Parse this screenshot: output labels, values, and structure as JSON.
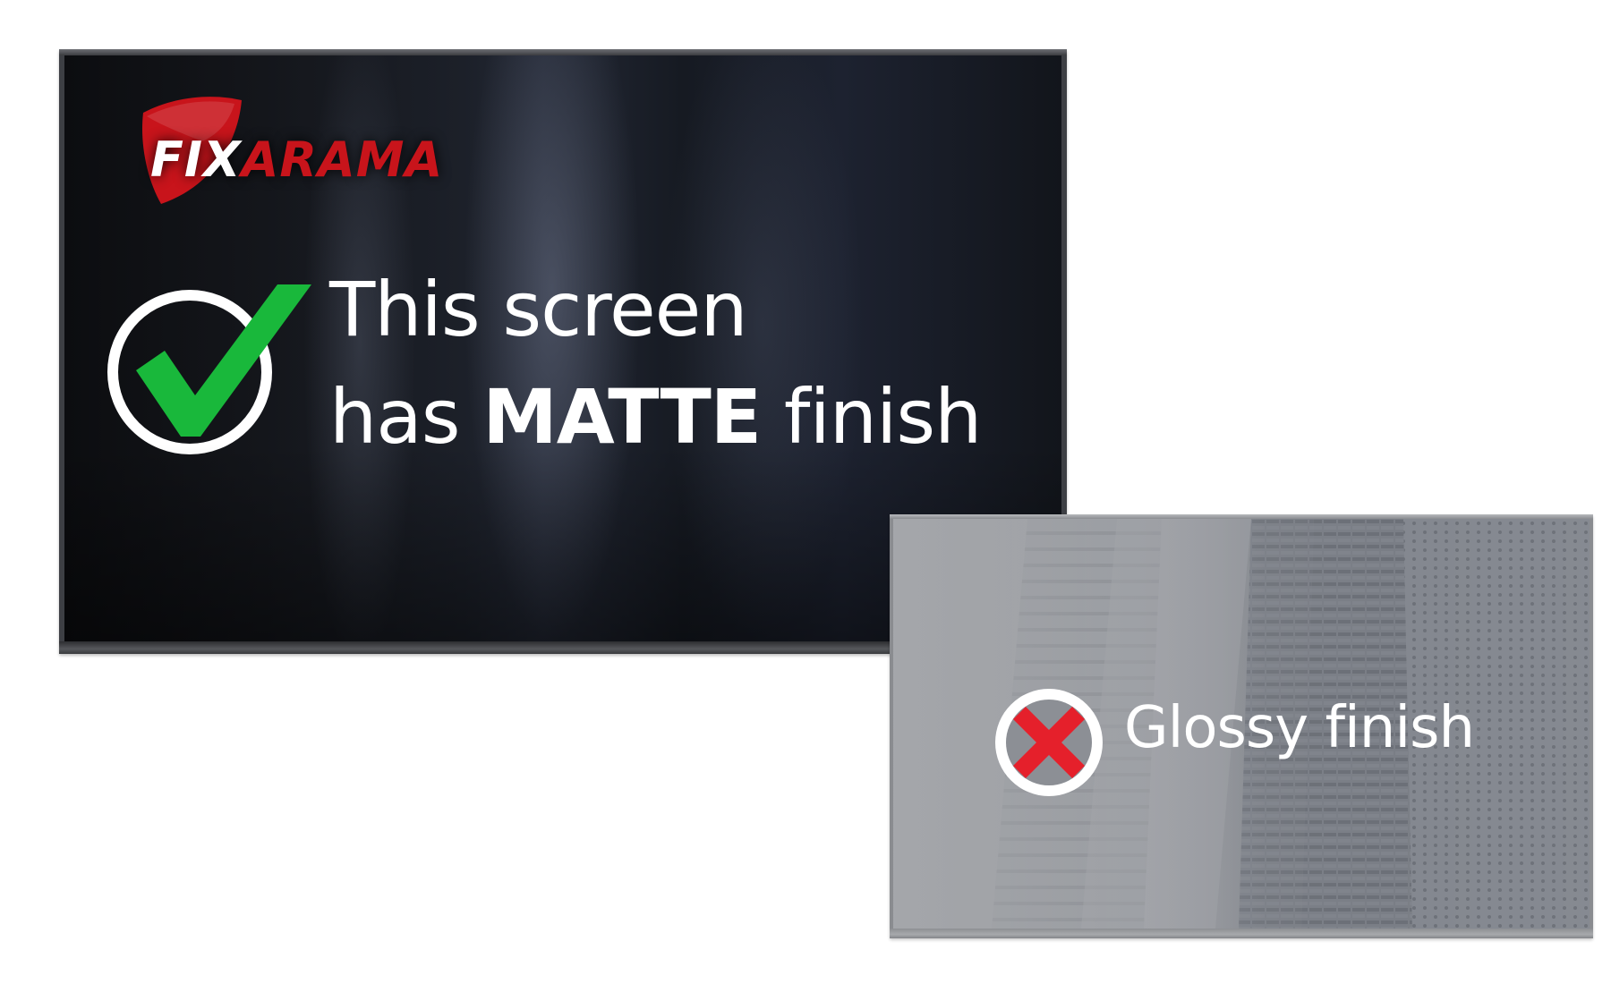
{
  "logo": {
    "part1": "FIX",
    "part2": "ARAMA",
    "brand_red": "#c8141b"
  },
  "matte": {
    "line1": "This screen",
    "line2_prefix": "has ",
    "line2_strong": "MATTE",
    "line2_suffix": " finish",
    "badge_icon": "check-icon",
    "check_color": "#19b83b"
  },
  "glossy": {
    "label": "Glossy finish",
    "badge_icon": "cross-icon",
    "cross_color": "#e5202b"
  }
}
